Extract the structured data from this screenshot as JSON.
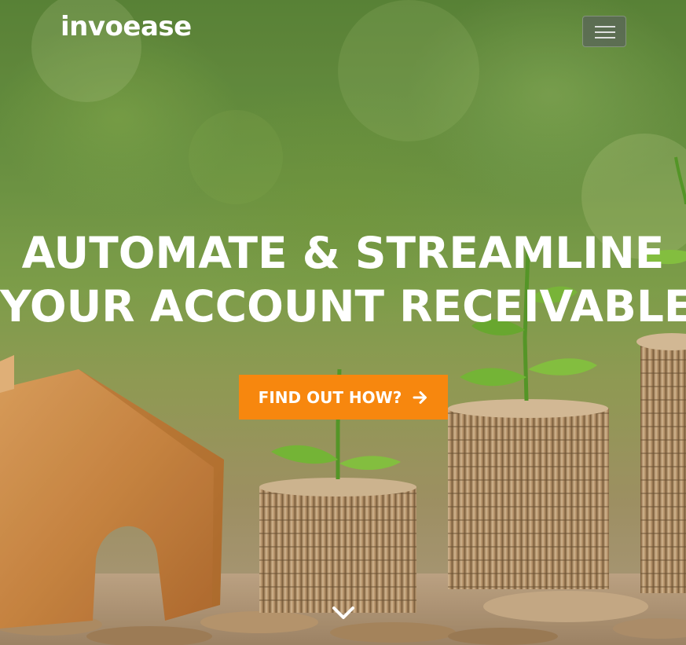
{
  "brand": {
    "name": "invoease"
  },
  "navbar": {
    "toggler_icon": "hamburger-icon"
  },
  "hero": {
    "headline_line1": "AUTOMATE & STREAMLINE",
    "headline_line2": "YOUR ACCOUNT RECEIVABLE",
    "cta_label": "FIND OUT HOW?",
    "cta_icon": "arrow-right-icon",
    "scroll_icon": "chevron-down-icon"
  },
  "colors": {
    "cta_background": "#f7870e",
    "text": "#ffffff"
  }
}
